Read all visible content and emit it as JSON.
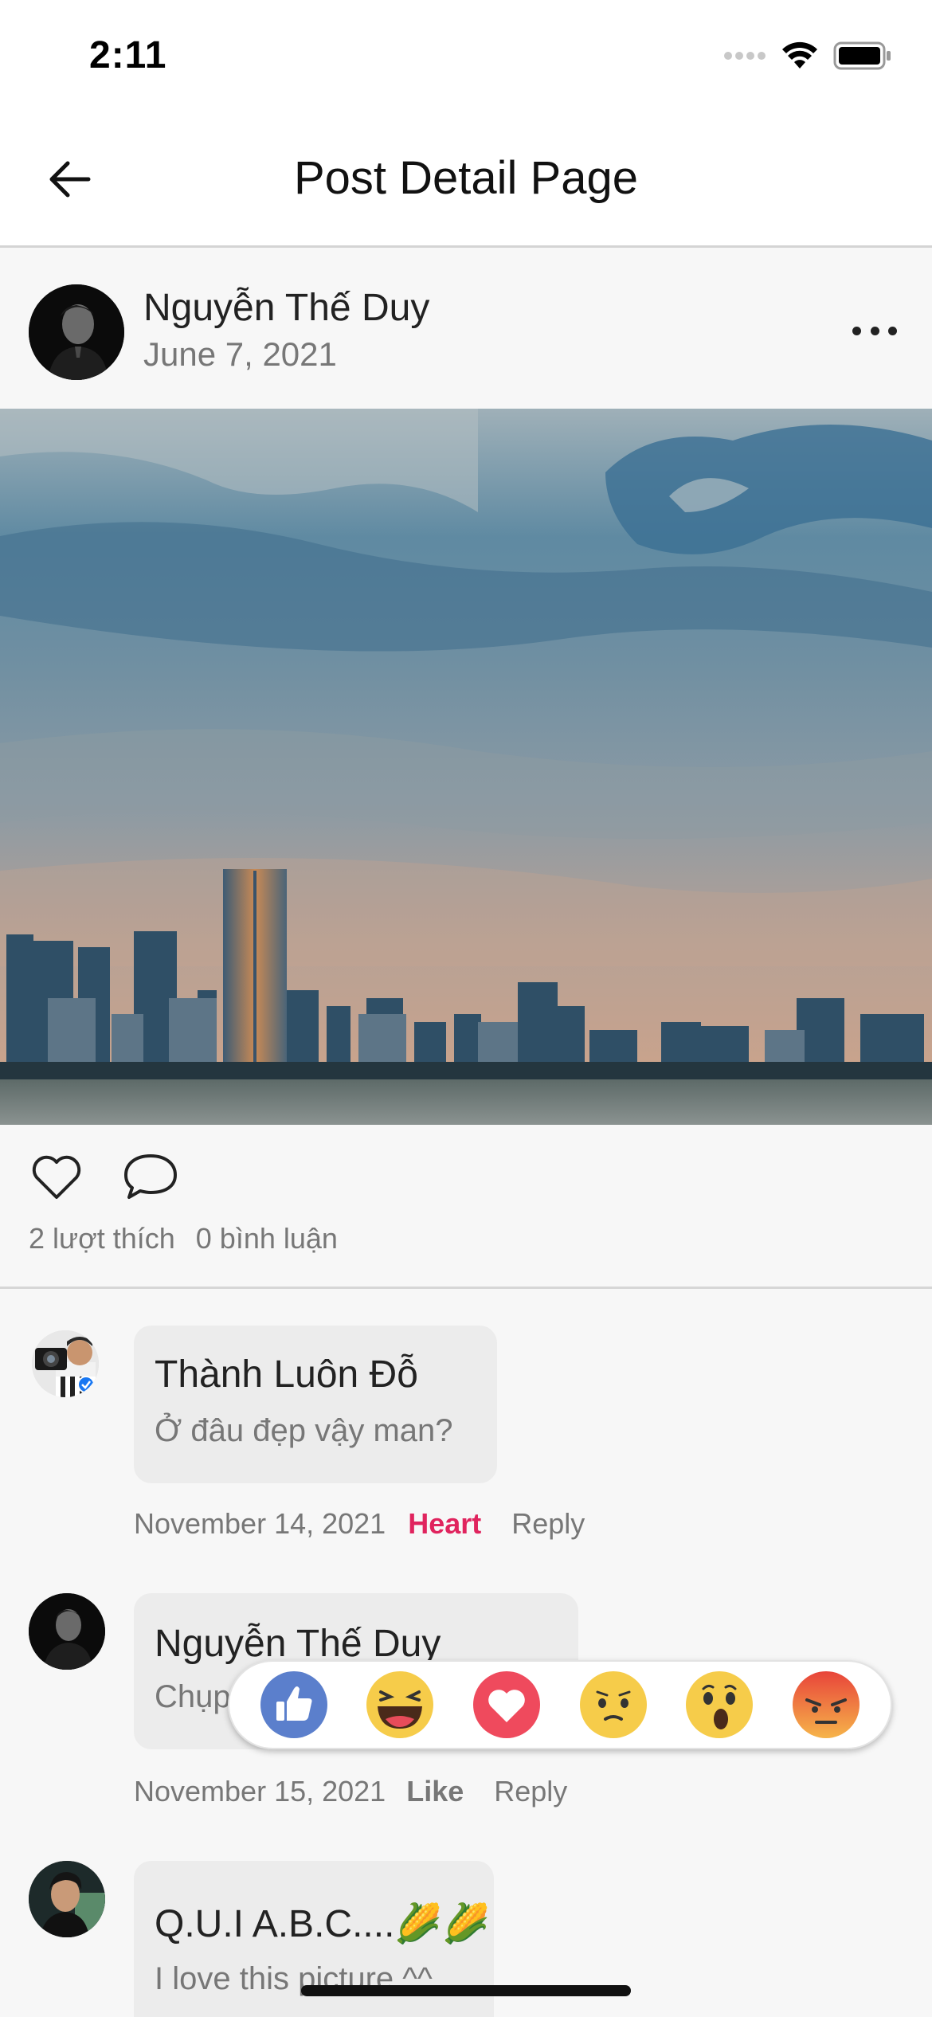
{
  "status_bar": {
    "time": "2:11"
  },
  "app_bar": {
    "title": "Post Detail Page",
    "back_icon": "arrow-left-icon"
  },
  "post": {
    "author": "Nguyễn Thế Duy",
    "date": "June 7, 2021",
    "more_icon": "more-horizontal-icon",
    "photo_icon": "city-skyline-photo",
    "likes_text": "2 lượt thích",
    "comments_text": "0 bình luận",
    "like_icon": "heart-outline-icon",
    "comment_icon": "comment-bubble-icon"
  },
  "comments": [
    {
      "name": "Thành Luôn Đỗ",
      "text": "Ở đâu đẹp vậy man?",
      "date": "November 14, 2021",
      "reaction_label": "Heart",
      "reaction_color": "#e0245e",
      "reply_label": "Reply"
    },
    {
      "name": "Nguyễn Thế Duy",
      "text": "Chụp ở Hồ Tây đó bạn",
      "date": "November 15, 2021",
      "reaction_label": "Like",
      "reaction_color": "#777777",
      "reply_label": "Reply"
    },
    {
      "name": "Q.U.I A.B.C....🌽🌽",
      "text": "I love this picture ^^",
      "date": "",
      "reaction_label": "",
      "reaction_color": "#777777",
      "reply_label": ""
    }
  ],
  "reactions": [
    "like-reaction-icon",
    "haha-reaction-icon",
    "love-reaction-icon",
    "sad-reaction-icon",
    "wow-reaction-icon",
    "angry-reaction-icon"
  ],
  "colors": {
    "accent": "#e0245e",
    "like_blue": "#5b7fcc",
    "love_red": "#ef4a5d",
    "emoji_yellow": "#f6cc4a",
    "angry_red": "#e8443a"
  }
}
